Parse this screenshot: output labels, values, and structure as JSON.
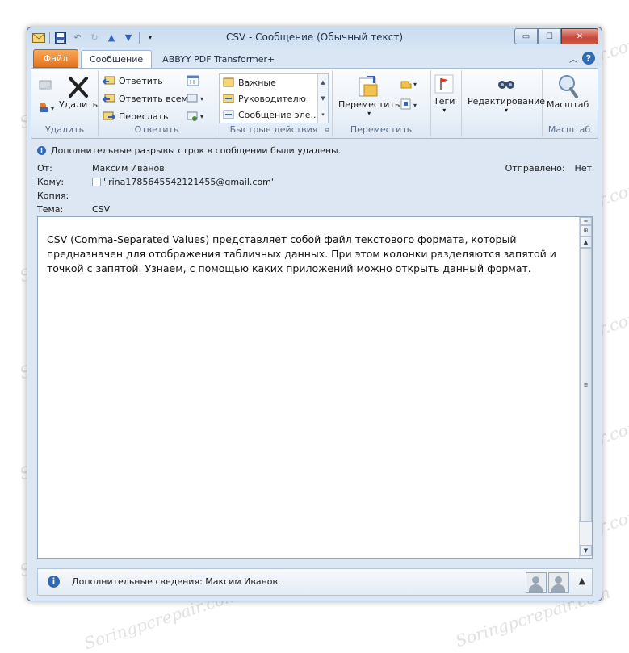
{
  "window": {
    "title": "CSV  -  Сообщение (Обычный текст)",
    "min": "▭",
    "max": "☐",
    "close": "✕"
  },
  "qat_icons": [
    "envelope-icon",
    "save-icon",
    "undo-icon",
    "redo-icon",
    "up-arrow-icon",
    "down-arrow-icon",
    "customize-icon"
  ],
  "tabs": {
    "file": "Файл",
    "message": "Сообщение",
    "abbyy": "ABBYY PDF Transformer+"
  },
  "ribbon": {
    "delete": {
      "label": "Удалить",
      "group": "Удалить"
    },
    "respond": {
      "reply": "Ответить",
      "reply_all": "Ответить всем",
      "forward": "Переслать",
      "group": "Ответить"
    },
    "quick_steps": {
      "items": [
        "Важные",
        "Руководителю",
        "Сообщение эле..."
      ],
      "group": "Быстрые действия"
    },
    "move": {
      "label": "Переместить",
      "group": "Переместить"
    },
    "tags": {
      "label": "Теги"
    },
    "editing": {
      "label": "Редактирование"
    },
    "zoom": {
      "label": "Масштаб",
      "group": "Масштаб"
    }
  },
  "header": {
    "infobar": "Дополнительные разрывы строк в сообщении были удалены.",
    "from_label": "От:",
    "from_value": "Максим Иванов",
    "to_label": "Кому:",
    "to_value": "'irina1785645542121455@gmail.com'",
    "cc_label": "Копия:",
    "subject_label": "Тема:",
    "subject_value": "CSV",
    "sent_label": "Отправлено:",
    "sent_value": "Нет"
  },
  "body": {
    "text": "CSV (Comma-Separated Values) представляет собой файл текстового формата, который предназначен для отображения табличных данных. При этом колонки разделяются запятой и точкой с запятой. Узнаем, с помощью каких приложений можно открыть данный формат."
  },
  "people_pane": {
    "text": "Дополнительные сведения: Максим Иванов."
  },
  "watermark": "Soringpcrepair.com"
}
